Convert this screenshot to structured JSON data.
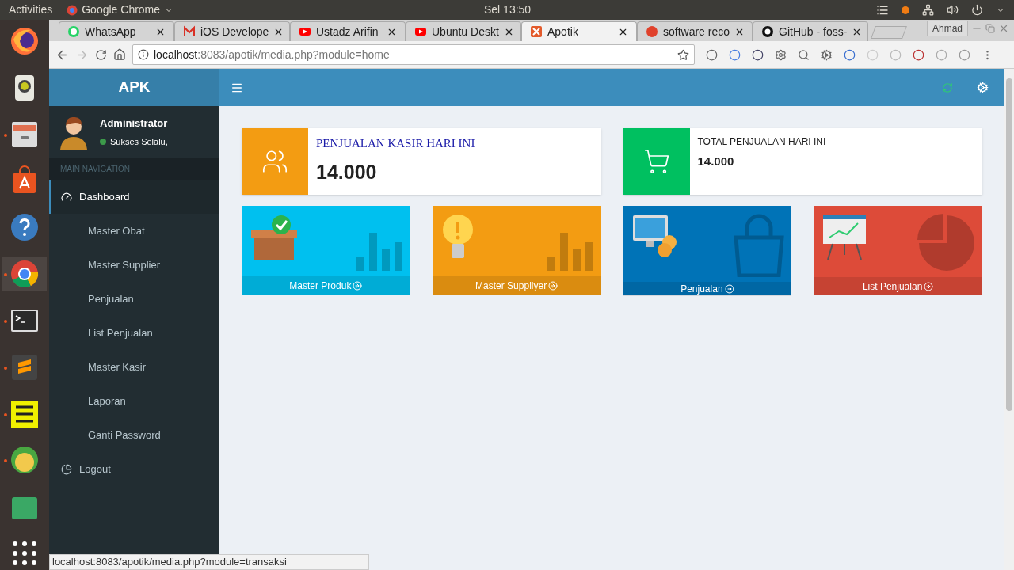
{
  "topbar": {
    "activities": "Activities",
    "app_menu": "Google Chrome",
    "clock": "Sel 13:50"
  },
  "dock": [
    {
      "kind": "firefox",
      "running": false
    },
    {
      "kind": "speaker",
      "running": false
    },
    {
      "kind": "files",
      "running": true
    },
    {
      "kind": "store",
      "running": false
    },
    {
      "kind": "help",
      "running": false
    },
    {
      "kind": "chrome",
      "running": true
    },
    {
      "kind": "terminal",
      "running": true
    },
    {
      "kind": "sublime",
      "running": true
    },
    {
      "kind": "notes",
      "running": true
    },
    {
      "kind": "hs",
      "running": true
    },
    {
      "kind": "green",
      "running": false
    },
    {
      "kind": "apps",
      "running": false
    }
  ],
  "tabs": [
    {
      "title": "WhatsApp",
      "kind": "whatsapp",
      "selected": false
    },
    {
      "title": "iOS Develope",
      "kind": "gmail",
      "selected": false
    },
    {
      "title": "Ustadz Arifin",
      "kind": "youtube",
      "selected": false
    },
    {
      "title": "Ubuntu Deskt",
      "kind": "youtube",
      "selected": false
    },
    {
      "title": "Apotik",
      "kind": "xampp",
      "selected": true
    },
    {
      "title": "software reco",
      "kind": "ask",
      "selected": false
    },
    {
      "title": "GitHub - foss-",
      "kind": "github",
      "selected": false
    }
  ],
  "profile": "Ahmad",
  "address": {
    "host": "localhost",
    "path": ":8083/apotik/media.php?module=home"
  },
  "app": {
    "brand": "APK",
    "user": {
      "name": "Administrator",
      "status": "Sukses Selalu,",
      "online": true
    },
    "nav_header": "MAIN NAVIGATION",
    "menu": [
      {
        "label": "Dashboard",
        "kind": "dashboard",
        "selected": true
      },
      {
        "label": "Master Obat",
        "kind": "sub",
        "selected": false
      },
      {
        "label": "Master Supplier",
        "kind": "sub",
        "selected": false
      },
      {
        "label": "Penjualan",
        "kind": "sub",
        "selected": false
      },
      {
        "label": "List Penjualan",
        "kind": "sub",
        "selected": false
      },
      {
        "label": "Master Kasir",
        "kind": "sub",
        "selected": false
      },
      {
        "label": "Laporan",
        "kind": "sub",
        "selected": false
      },
      {
        "label": "Ganti Password",
        "kind": "sub",
        "selected": false
      },
      {
        "label": "Logout",
        "kind": "logout",
        "selected": false
      }
    ],
    "info_boxes": [
      {
        "title": "PENJUALAN KASIR HARI INI",
        "value": "14.000",
        "kind": "kasir",
        "color": "#f39c12"
      },
      {
        "title": "TOTAL PENJUALAN HARI INI",
        "value": "14.000",
        "kind": "total",
        "color": "#00c060"
      }
    ],
    "tiles": [
      {
        "label": "Master Produk",
        "kind": "produk",
        "color": "#00c0ef"
      },
      {
        "label": "Master Suppliyer",
        "kind": "supplier",
        "color": "#f39c12"
      },
      {
        "label": "Penjualan",
        "kind": "penjualan",
        "color": "#0073b7"
      },
      {
        "label": "List Penjualan",
        "kind": "list",
        "color": "#dd4b39"
      }
    ]
  },
  "status_url": "localhost:8083/apotik/media.php?module=transaksi"
}
